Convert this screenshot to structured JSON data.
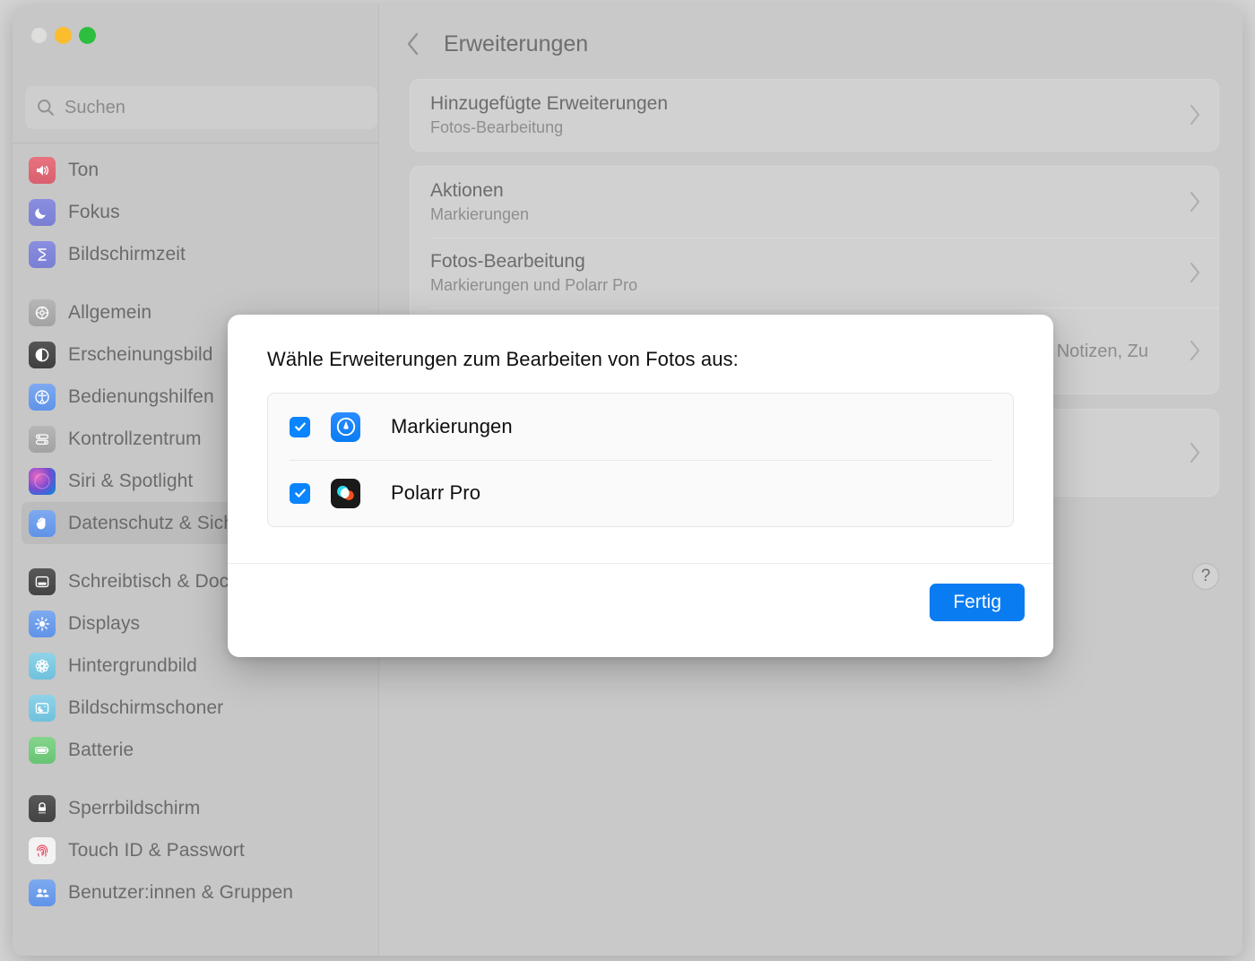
{
  "window": {
    "traffic_lights": [
      "close",
      "minimize",
      "maximize"
    ]
  },
  "sidebar": {
    "search": {
      "placeholder": "Suchen",
      "value": ""
    },
    "groups": [
      {
        "items": [
          {
            "label": "Ton",
            "icon": "speaker-icon",
            "selected": false
          },
          {
            "label": "Fokus",
            "icon": "moon-icon",
            "selected": false
          },
          {
            "label": "Bildschirmzeit",
            "icon": "hourglass-icon",
            "selected": false
          }
        ]
      },
      {
        "items": [
          {
            "label": "Allgemein",
            "icon": "gear-icon",
            "selected": false
          },
          {
            "label": "Erscheinungsbild",
            "icon": "appearance-icon",
            "selected": false
          },
          {
            "label": "Bedienungshilfen",
            "icon": "accessibility-icon",
            "selected": false
          },
          {
            "label": "Kontrollzentrum",
            "icon": "sliders-icon",
            "selected": false
          },
          {
            "label": "Siri & Spotlight",
            "icon": "siri-icon",
            "selected": false
          },
          {
            "label": "Datenschutz & Sicherheit",
            "icon": "hand-icon",
            "selected": true
          }
        ]
      },
      {
        "items": [
          {
            "label": "Schreibtisch & Dock",
            "icon": "dock-icon",
            "selected": false
          },
          {
            "label": "Displays",
            "icon": "brightness-icon",
            "selected": false
          },
          {
            "label": "Hintergrundbild",
            "icon": "wallpaper-icon",
            "selected": false
          },
          {
            "label": "Bildschirmschoner",
            "icon": "screensaver-icon",
            "selected": false
          },
          {
            "label": "Batterie",
            "icon": "battery-icon",
            "selected": false
          }
        ]
      },
      {
        "items": [
          {
            "label": "Sperrbildschirm",
            "icon": "lock-icon",
            "selected": false
          },
          {
            "label": "Touch ID & Passwort",
            "icon": "fingerprint-icon",
            "selected": false
          },
          {
            "label": "Benutzer:innen & Gruppen",
            "icon": "users-icon",
            "selected": false
          }
        ]
      }
    ]
  },
  "main": {
    "back_label": "",
    "title": "Erweiterungen",
    "help_label": "?",
    "cards": [
      {
        "rows": [
          {
            "title": "Hinzugefügte Erweiterungen",
            "subtitle": "Fotos-Bearbeitung",
            "chevron": true
          }
        ]
      },
      {
        "rows": [
          {
            "title": "Aktionen",
            "subtitle": "Markierungen",
            "chevron": true
          },
          {
            "title": "Fotos-Bearbeitung",
            "subtitle": "Markierungen und Polarr Pro",
            "chevron": true
          },
          {
            "title": "",
            "subtitle": ", Notizen, Zu",
            "chevron": true
          }
        ]
      },
      {
        "rows": [
          {
            "title": "",
            "subtitle": "",
            "chevron": true
          }
        ]
      }
    ]
  },
  "sheet": {
    "title": "Wähle Erweiterungen zum Bearbeiten von Fotos aus:",
    "extensions": [
      {
        "name": "Markierungen",
        "checked": true,
        "icon": "markup-icon"
      },
      {
        "name": "Polarr Pro",
        "checked": true,
        "icon": "polarr-icon"
      }
    ],
    "done_label": "Fertig"
  },
  "colors": {
    "accent": "#0a84ff",
    "done_button": "#0a7cf2",
    "sidebar_bg": "#c7c7c7",
    "main_bg": "#c9c9c9",
    "sheet_bg": "#ffffff",
    "traffic_yellow": "#fbbd2e",
    "traffic_green": "#2dbe3f"
  }
}
